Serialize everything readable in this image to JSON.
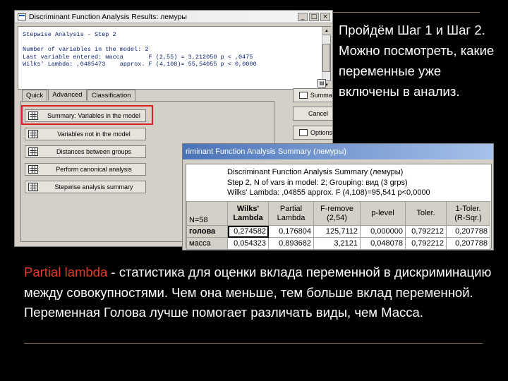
{
  "window1": {
    "title": "Discriminant Function Analysis Results: лемуры",
    "buttons": [
      "_",
      "□",
      "×"
    ],
    "output_lines": [
      "Stepwise Analysis - Step 2",
      "",
      "Number of variables in the model: 2",
      "Last variable entered: масса       F (2,55) = 3,212050 p < ,0475",
      "Wilks' Lambda: ,0485473    approx. F (4,108)= 55,54055 p < 0,0000"
    ],
    "tabs": [
      "Quick",
      "Advanced",
      "Classification"
    ],
    "active_tab": "Advanced",
    "options": [
      "Summary: Variables in the model",
      "Variables not in the model",
      "Distances between groups",
      "Perform canonical analysis",
      "Stepwise analysis summary"
    ],
    "side_buttons": [
      "Summary",
      "Cancel",
      "Options ▾"
    ]
  },
  "window2": {
    "title": "riminant Function Analysis Summary (лемуры)",
    "header_lines": [
      "Discriminant Function Analysis Summary (лемуры)",
      "Step 2, N of vars in model: 2; Grouping: вид (3 grps)",
      "Wilks' Lambda: ,04855 approx. F (4,108)=95,541 p<0,0000"
    ],
    "n_label": "N=58",
    "columns": [
      {
        "line1": "Wilks'",
        "line2": "Lambda",
        "bold": true
      },
      {
        "line1": "Partial",
        "line2": "Lambda",
        "bold": false
      },
      {
        "line1": "F-remove",
        "line2": "(2,54)",
        "bold": false
      },
      {
        "line1": "p-level",
        "line2": "",
        "bold": false
      },
      {
        "line1": "Toler.",
        "line2": "",
        "bold": false
      },
      {
        "line1": "1-Toler.",
        "line2": "(R-Sqr.)",
        "bold": false
      }
    ],
    "rows": [
      {
        "name": "голова",
        "values": [
          "0,274582",
          "0,176804",
          "125,7112",
          "0,000000",
          "0,792212",
          "0,207788"
        ]
      },
      {
        "name": "масса",
        "values": [
          "0,054323",
          "0,893682",
          "3,2121",
          "0,048078",
          "0,792212",
          "0,207788"
        ]
      }
    ]
  },
  "right_text": "Пройдём Шаг 1 и Шаг 2. Можно посмотреть, какие переменные уже включены в анализ.",
  "bottom_text": {
    "highlight": "Partial lambda",
    "rest": " - статистика для оценки вклада переменной в дискриминацию между совокупностями. Чем она меньше, тем больше вклад переменной.",
    "line2": "Переменная Голова лучше помогает различать виды, чем Масса."
  },
  "colors": {
    "background": "#000000",
    "accent_red": "#e83a2a",
    "title_blue": "#4a73b8"
  }
}
